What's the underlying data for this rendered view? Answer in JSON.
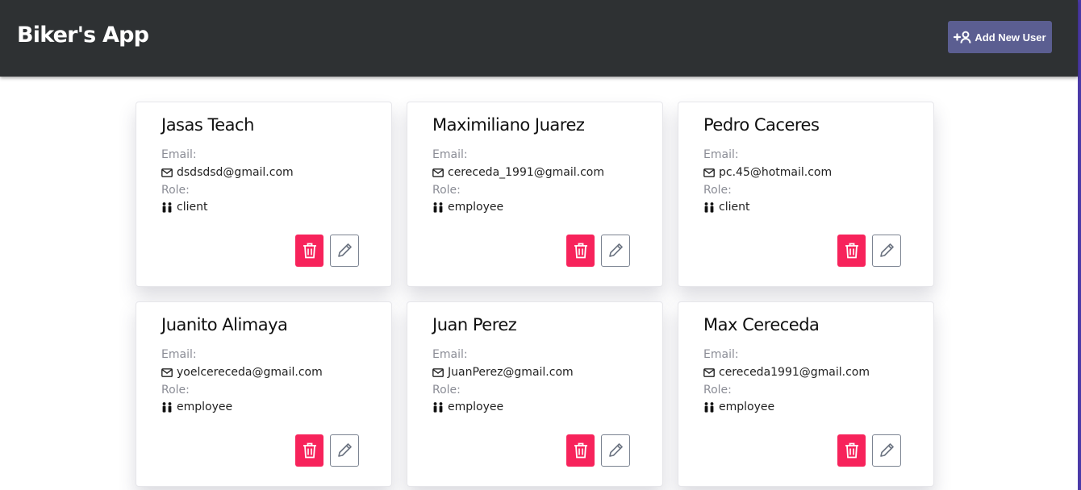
{
  "app": {
    "title": "Biker's App",
    "add_user_label": "Add New User"
  },
  "colors": {
    "navbar": "#2e3133",
    "add_button": "#5b5e91",
    "delete_button": "#f7235b",
    "edge_accent": "#4b3aa8"
  },
  "labels": {
    "email": "Email:",
    "role": "Role:"
  },
  "users": [
    {
      "name": "Jasas Teach",
      "email": "dsdsdsd@gmail.com",
      "role": "client"
    },
    {
      "name": "Maximiliano Juarez",
      "email": "cereceda_1991@gmail.com",
      "role": "employee"
    },
    {
      "name": "Pedro Caceres",
      "email": "pc.45@hotmail.com",
      "role": "client"
    },
    {
      "name": "Juanito Alimaya",
      "email": "yoelcereceda@gmail.com",
      "role": "employee"
    },
    {
      "name": "Juan Perez",
      "email": "JuanPerez@gmail.com",
      "role": "employee"
    },
    {
      "name": "Max Cereceda",
      "email": "cereceda1991@gmail.com",
      "role": "employee"
    }
  ]
}
